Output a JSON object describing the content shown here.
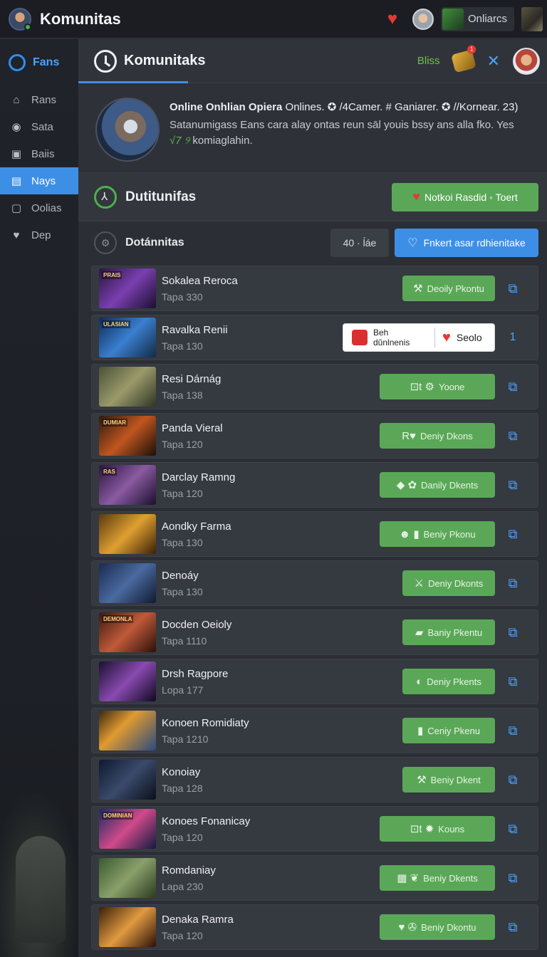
{
  "topbar": {
    "app_title": "Komunitas",
    "online_label": "Onliarcs"
  },
  "sidebar": {
    "brand": "Fans",
    "items": [
      {
        "label": "Rans",
        "icon": "handshake-icon",
        "glyph": "⌂"
      },
      {
        "label": "Sata",
        "icon": "location-pin-icon",
        "glyph": "◉"
      },
      {
        "label": "Baiis",
        "icon": "camera-icon",
        "glyph": "▣"
      },
      {
        "label": "Nays",
        "icon": "book-icon",
        "glyph": "▤",
        "active": true
      },
      {
        "label": "Oolias",
        "icon": "picture-icon",
        "glyph": "▢"
      },
      {
        "label": "Dep",
        "icon": "heart-icon",
        "glyph": "♥"
      }
    ]
  },
  "header": {
    "title": "Komunitaks",
    "bliss_label": "Bliss",
    "coin_badge": "1"
  },
  "profile": {
    "name": "Online Onhlian Opiera",
    "line1_rest": " Onlines. ✪ /4Camer. # Ganiarer. ✪ //Kornear. 23)",
    "line2": "Satanumigass Eans cara alay ontas reun sāl youis bssy ans alla fko. Yes",
    "green": "√7 ୨",
    "line3": " komiaglahin."
  },
  "section": {
    "title": "Dutitunifas",
    "notify_label": "Notkoi Rasdid ◦ Toert"
  },
  "filter": {
    "title": "Dotánnitas",
    "count": "40 · ĺáe",
    "find_label": "Fnkert asar rdhienitake"
  },
  "tooltip": {
    "left_line1": "Beh",
    "left_line2": "dŭnlnenis",
    "right": "Seolo",
    "share_num": "1"
  },
  "rows": [
    {
      "name": "Sokalea Reroca",
      "sub": "Tapa 330",
      "action": "Deoily Pkontu",
      "icons": "⚒",
      "tag": "PRAIS",
      "bg": "linear-gradient(135deg,#2a1640,#7a3fb0 50%,#1b0f2e)",
      "w": 130
    },
    {
      "name": "Ravalka Renii",
      "sub": "Tapa 130",
      "tooltip": true,
      "tag": "ULASIAN",
      "bg": "linear-gradient(135deg,#0f2a55,#3a7fd0 50%,#122a44)"
    },
    {
      "name": "Resi Dárnág",
      "sub": "Tapa 138",
      "action": "Yoone",
      "icons": "⊡t ⚙",
      "tag": "",
      "bg": "linear-gradient(135deg,#4b5238,#9a9a6a 50%,#2f3426)",
      "w": 162
    },
    {
      "name": "Panda Vieral",
      "sub": "Tapa 120",
      "action": "Deniy Dkons",
      "icons": "R♥",
      "tag": "DUMIAR",
      "bg": "linear-gradient(135deg,#2a1a10,#c0561f 50%,#1a0f08)",
      "w": 162
    },
    {
      "name": "Darclay Ramng",
      "sub": "Tapa 120",
      "action": "Danily Dkents",
      "icons": "◆ ✿",
      "tag": "RAS",
      "bg": "linear-gradient(135deg,#2a1640,#8a5aa0 50%,#1b0f2e)",
      "w": 162
    },
    {
      "name": "Aondky Farma",
      "sub": "Tapa 130",
      "action": "Beniy Pkonu",
      "icons": "☻ ▮",
      "tag": "",
      "bg": "linear-gradient(135deg,#5a3a10,#e0a030 50%,#3a2008)",
      "w": 162
    },
    {
      "name": "Denoáy",
      "sub": "Tapa 130",
      "action": "Deniy Dkonts",
      "icons": "⚔",
      "tag": "",
      "bg": "linear-gradient(135deg,#1a2a50,#4a6aa0 50%,#101a30)",
      "w": 130
    },
    {
      "name": "Docden Oeioly",
      "sub": "Tapa 1110",
      "action": "Baniy Pkentu",
      "icons": "▰",
      "tag": "DEMONLA",
      "bg": "linear-gradient(135deg,#3a1a10,#c05a3a 50%,#2a0f08)",
      "w": 130
    },
    {
      "name": "Drsh Ragpore",
      "sub": "Lopa 177",
      "action": "Deniy Pkents",
      "icons": "◐",
      "tag": "",
      "bg": "linear-gradient(135deg,#1a1030,#8a4ab0 50%,#0f0820)",
      "w": 130
    },
    {
      "name": "Konoen Romidiaty",
      "sub": "Tapa 1210",
      "action": "Ceniy Pkenu",
      "icons": "▮",
      "tag": "",
      "bg": "linear-gradient(135deg,#3a2a10,#e09a30 40%,#2a4a80)",
      "w": 130
    },
    {
      "name": "Konoiay",
      "sub": "Tapa 128",
      "action": "Beniy Dkent",
      "icons": "⚒",
      "tag": "",
      "bg": "linear-gradient(135deg,#0f1a30,#3a4a6a 50%,#0a0f1a)",
      "w": 130
    },
    {
      "name": "Konoes Fonanicay",
      "sub": "Tapa 120",
      "action": "Kouns",
      "icons": "⊡t ✹",
      "tag": "DOMINIAN",
      "bg": "linear-gradient(135deg,#1a2a60,#d04a8a 50%,#101a40)",
      "w": 162
    },
    {
      "name": "Romdaniay",
      "sub": "Lapa 230",
      "action": "Beniy Dkents",
      "icons": "▦ ❦",
      "tag": "",
      "bg": "linear-gradient(135deg,#3a5a30,#8aa06a 50%,#2a3a20)",
      "w": 162
    },
    {
      "name": "Denaka Ramra",
      "sub": "Tapa 120",
      "action": "Beniy Dkontu",
      "icons": "♥ ✇",
      "tag": "",
      "bg": "linear-gradient(135deg,#3a2008,#e09a40 50%,#2a1008)",
      "w": 162
    }
  ]
}
